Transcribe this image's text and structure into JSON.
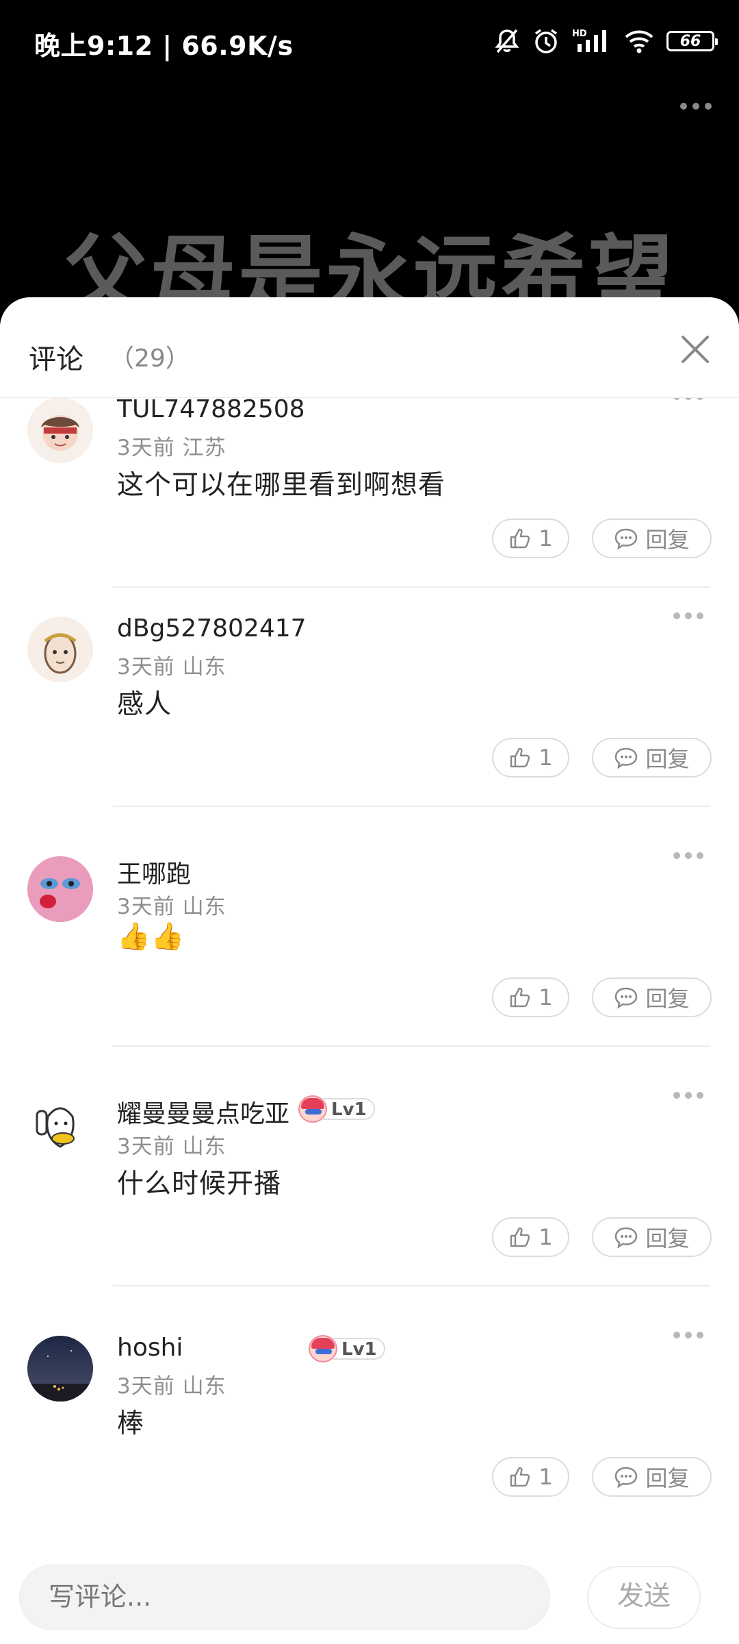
{
  "status_bar": {
    "time": "晚上9:12 | 66.9K/s",
    "battery": "66",
    "icons": [
      "mute-bell-icon",
      "alarm-icon",
      "hd-signal-icon",
      "wifi-icon",
      "battery-icon"
    ]
  },
  "video": {
    "title_text": "父母是永远希望",
    "more_icon": "more-dots-icon"
  },
  "sheet": {
    "title": "评论",
    "count": "（29）",
    "close_icon": "close-icon"
  },
  "comments": [
    {
      "username": "TUL747882508",
      "meta": "3天前 江苏",
      "content": "这个可以在哪里看到啊想看",
      "likes": "1",
      "reply_label": "回复",
      "badge": ""
    },
    {
      "username": "dBg527802417",
      "meta": "3天前 山东",
      "content": "感人",
      "likes": "1",
      "reply_label": "回复",
      "badge": ""
    },
    {
      "username": "王哪跑",
      "meta": "3天前 山东",
      "content": "👍👍",
      "likes": "1",
      "reply_label": "回复",
      "badge": ""
    },
    {
      "username": "耀曼曼曼点吃亚",
      "meta": "3天前 山东",
      "content": "什么时候开播",
      "likes": "1",
      "reply_label": "回复",
      "badge": "Lv1"
    },
    {
      "username": "hoshi",
      "meta": "3天前 山东",
      "content": "棒",
      "likes": "1",
      "reply_label": "回复",
      "badge": "Lv1"
    }
  ],
  "bottom_bar": {
    "input_placeholder": "写评论...",
    "send_label": "发送"
  },
  "colors": {
    "text_primary": "#222222",
    "text_secondary": "#8f8f8f",
    "divider": "#ececec",
    "pill_border": "#dcdcdc"
  }
}
